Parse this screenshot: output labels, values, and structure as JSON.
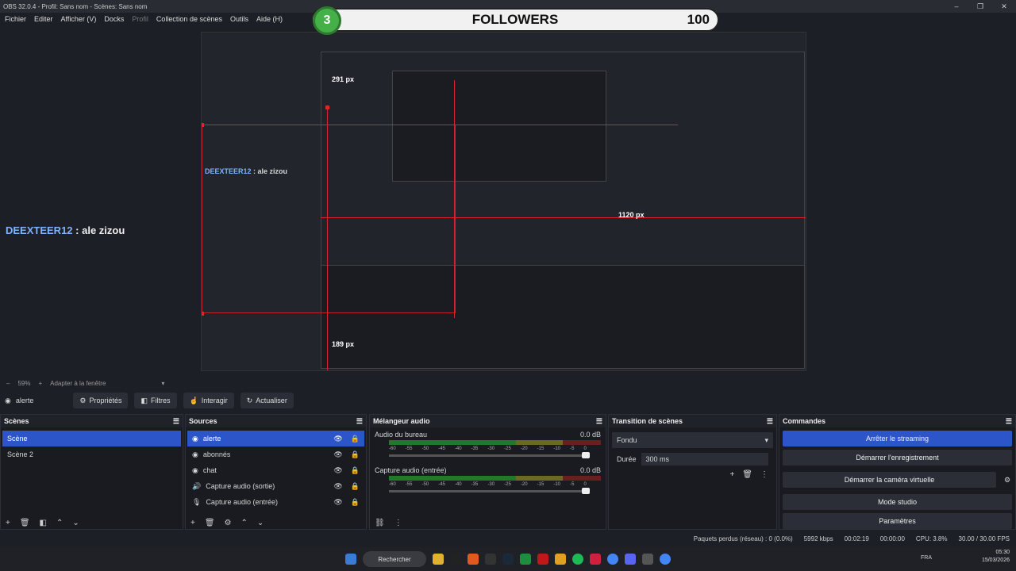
{
  "window": {
    "title": "OBS 32.0.4 - Profil: Sans nom - Scènes: Sans nom"
  },
  "menu": [
    "Fichier",
    "Editer",
    "Afficher (V)",
    "Docks",
    "Profil",
    "Collection de scènes",
    "Outils",
    "Aide (H)"
  ],
  "followers": {
    "count_badge": "3",
    "label": "FOLLOWERS",
    "total": "100"
  },
  "preview": {
    "chat_user": "DEEXTEER12",
    "chat_sep": " : ",
    "chat_msg": "ale zizou",
    "px_291": "291 px",
    "px_1120": "1120 px",
    "px_189": "189 px"
  },
  "zoom": {
    "level": "59%",
    "fit": "Adapter à la fenêtre"
  },
  "source_toolbar": {
    "name": "alerte",
    "props": "Propriétés",
    "filters": "Filtres",
    "interact": "Interagir",
    "refresh": "Actualiser"
  },
  "scenes": {
    "title": "Scènes",
    "items": [
      "Scène",
      "Scène 2"
    ]
  },
  "sources": {
    "title": "Sources",
    "items": [
      "alerte",
      "abonnés",
      "chat",
      "Capture audio (sortie)",
      "Capture audio (entrée)"
    ]
  },
  "mixer": {
    "title": "Mélangeur audio",
    "channels": [
      {
        "name": "Audio du bureau",
        "db": "0.0 dB"
      },
      {
        "name": "Capture audio (entrée)",
        "db": "0.0 dB"
      }
    ],
    "ticks": [
      "-60",
      "-55",
      "-50",
      "-45",
      "-40",
      "-35",
      "-30",
      "-25",
      "-20",
      "-15",
      "-10",
      "-5",
      "0"
    ]
  },
  "transitions": {
    "title": "Transition de scènes",
    "selected": "Fondu",
    "duration_label": "Durée",
    "duration": "300 ms"
  },
  "controls": {
    "title": "Commandes",
    "stop_stream": "Arrêter le streaming",
    "start_rec": "Démarrer l'enregistrement",
    "virtual_cam": "Démarrer la caméra virtuelle",
    "studio": "Mode studio",
    "settings": "Paramètres"
  },
  "status": {
    "dropped": "Paquets perdus (réseau) : 0 (0.0%)",
    "bitrate": "5992 kbps",
    "stream_time": "00:02:19",
    "rec_time": "00:00:00",
    "cpu": "CPU: 3.8%",
    "fps": "30.00 / 30.00 FPS"
  },
  "taskbar": {
    "search": "Rechercher",
    "time": "05:30",
    "date": "15/03/2026",
    "lang": "FRA"
  },
  "colors": {
    "accent": "#2c55c9",
    "rec_red": "#d42230",
    "badge_green": "#46b048"
  }
}
